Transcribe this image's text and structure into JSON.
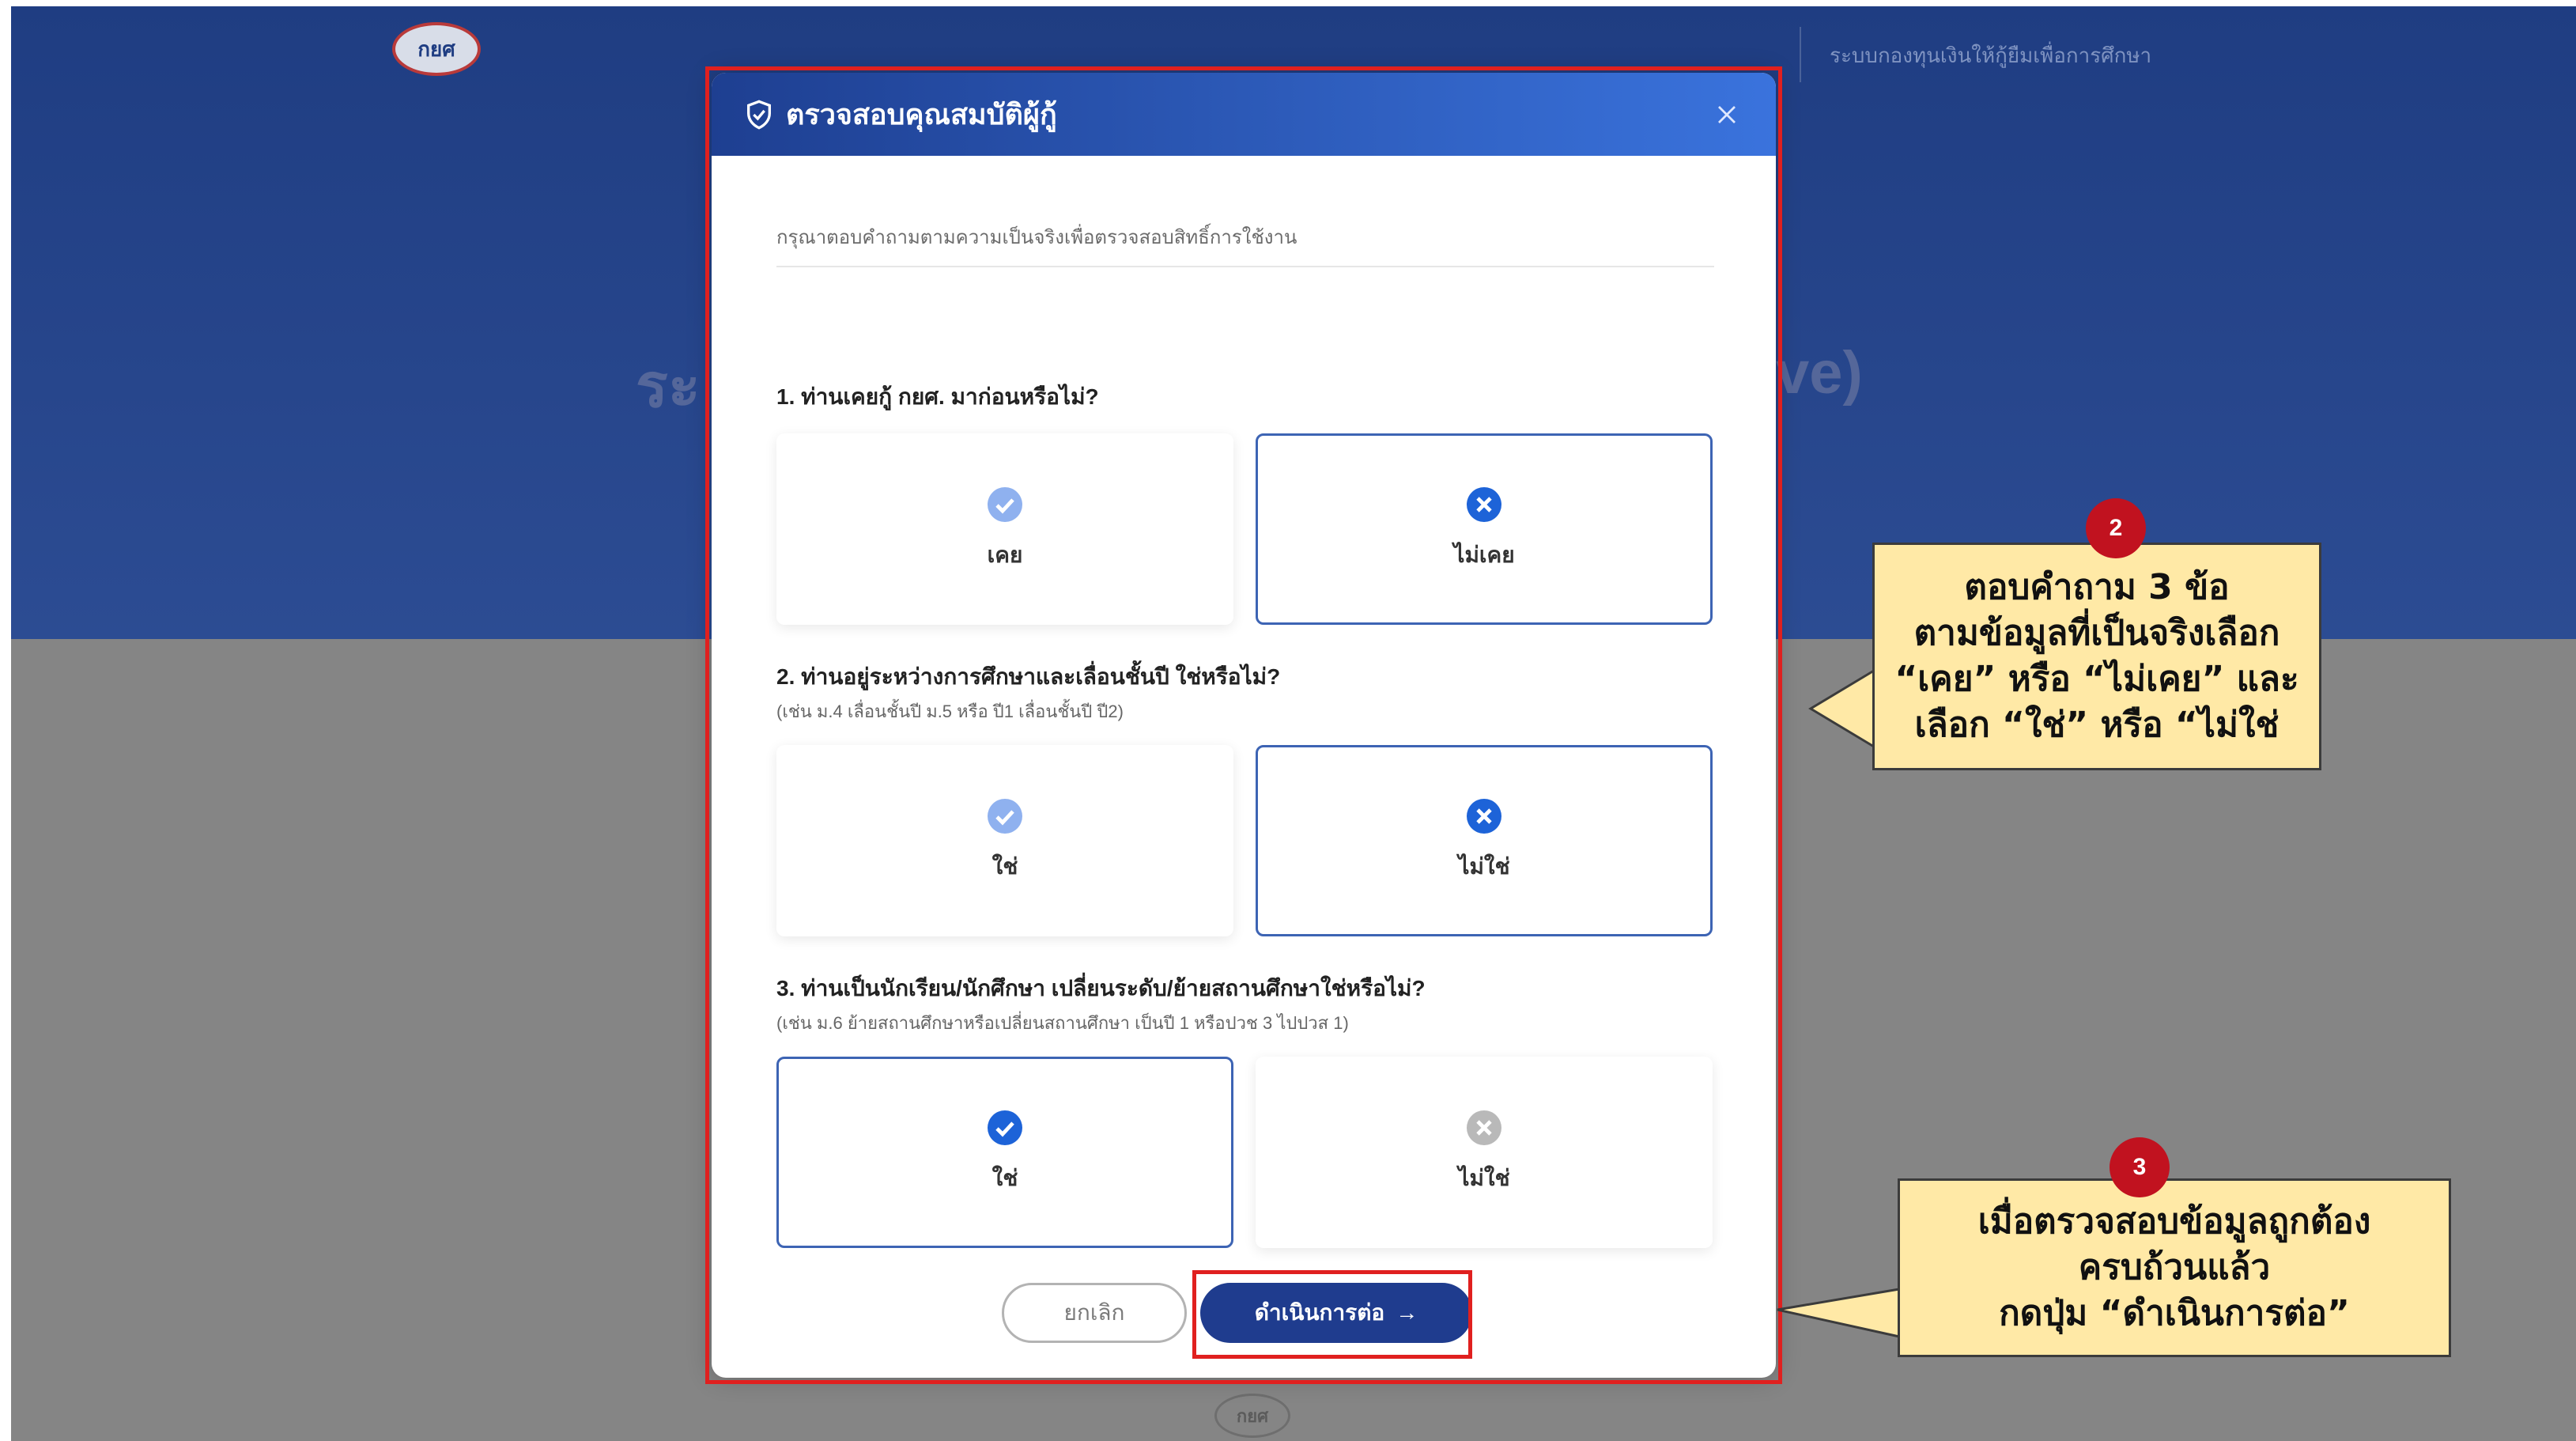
{
  "app": {
    "logo_text": "กยศ",
    "system_name": "ระบบกองทุนเงินให้กู้ยืมเพื่อการศึกษา",
    "hero_left": "ระ",
    "hero_right": "ve)"
  },
  "dialog": {
    "title": "ตรวจสอบคุณสมบัติผู้กู้",
    "intro": "กรุณาตอบคำถามตามความเป็นจริงเพื่อตรวจสอบสิทธิ์การใช้งาน",
    "questions": [
      {
        "title": "1. ท่านเคยกู้ กยศ. มาก่อนหรือไม่?",
        "hint": "",
        "options": [
          {
            "label": "เคย",
            "selected": false
          },
          {
            "label": "ไม่เคย",
            "selected": true
          }
        ]
      },
      {
        "title": "2. ท่านอยู่ระหว่างการศึกษาและเลื่อนชั้นปี ใช่หรือไม่?",
        "hint": "(เช่น ม.4 เลื่อนชั้นปี ม.5 หรือ ปี1 เลื่อนชั้นปี ปี2)",
        "options": [
          {
            "label": "ใช่",
            "selected": false
          },
          {
            "label": "ไม่ใช่",
            "selected": true
          }
        ]
      },
      {
        "title": "3. ท่านเป็นนักเรียน/นักศึกษา เปลี่ยนระดับ/ย้ายสถานศึกษาใช่หรือไม่?",
        "hint": "(เช่น ม.6 ย้ายสถานศึกษาหรือเปลี่ยนสถานศึกษา เป็นปี 1 หรือปวช 3 ไปปวส 1)",
        "options": [
          {
            "label": "ใช่",
            "selected": true
          },
          {
            "label": "ไม่ใช่",
            "selected": false
          }
        ]
      }
    ],
    "cancel_label": "ยกเลิก",
    "continue_label": "ดำเนินการต่อ",
    "continue_arrow": "→"
  },
  "annotations": {
    "step2_badge": "2",
    "step2_lines": [
      "ตอบคำถาม 3 ข้อ",
      "ตามข้อมูลที่เป็นจริงเลือก",
      "“เคย” หรือ “ไม่เคย” และ",
      "เลือก “ใช่” หรือ “ไม่ใช่"
    ],
    "step3_badge": "3",
    "step3_lines": [
      "เมื่อตรวจสอบข้อมูลถูกต้อง",
      "ครบถ้วนแล้ว",
      "กดปุ่ม “ดำเนินการต่อ”"
    ]
  },
  "colors": {
    "header_blue": "#1f3d82",
    "primary_button": "#1f3c8e",
    "selected_border": "#3d64b4",
    "highlight_red": "#e0201f",
    "callout_yellow": "#ffe9a6",
    "badge_red": "#c1121f"
  },
  "icons": {
    "dialog": "shield-check-icon",
    "close": "close-icon",
    "selected_check": "check-circle-icon",
    "selected_x": "x-circle-icon",
    "muted_check": "check-circle-muted-icon",
    "muted_x": "x-circle-muted-icon"
  }
}
